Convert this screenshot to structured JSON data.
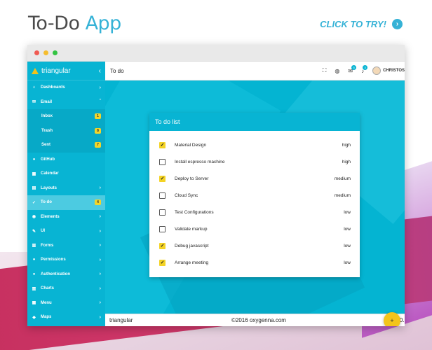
{
  "headline": {
    "prefix": "To-Do",
    "accent": "App"
  },
  "cta": {
    "label": "CLICK TO TRY!",
    "icon": "chevron-right-icon"
  },
  "brand": {
    "name": "triangular",
    "collapse_icon": "‹"
  },
  "sidebar": {
    "items": [
      {
        "label": "Dashboards",
        "icon": "⌂",
        "arrow": "›"
      },
      {
        "label": "Email",
        "icon": "✉",
        "arrow": "ˇ"
      },
      {
        "label": "Inbox",
        "badge": "1"
      },
      {
        "label": "Trash",
        "badge": "8"
      },
      {
        "label": "Sent",
        "badge": "7"
      },
      {
        "label": "GitHub",
        "icon": "●"
      },
      {
        "label": "Calendar",
        "icon": "▦"
      },
      {
        "label": "Layouts",
        "icon": "▤",
        "arrow": "›"
      },
      {
        "label": "To do",
        "icon": "✓",
        "badge": "4"
      },
      {
        "label": "Elements",
        "icon": "◉",
        "arrow": "›"
      },
      {
        "label": "UI",
        "icon": "✎",
        "arrow": "›"
      },
      {
        "label": "Forms",
        "icon": "▥",
        "arrow": "›"
      },
      {
        "label": "Permissions",
        "icon": "●",
        "arrow": "›"
      },
      {
        "label": "Authentication",
        "icon": "●",
        "arrow": "›"
      },
      {
        "label": "Charts",
        "icon": "▥",
        "arrow": "›"
      },
      {
        "label": "Menu",
        "icon": "▦",
        "arrow": "›"
      },
      {
        "label": "Maps",
        "icon": "◆",
        "arrow": "›"
      }
    ]
  },
  "topbar": {
    "title": "To do",
    "fullscreen_icon": "⛶",
    "globe_icon": "◍",
    "mail_icon": "✉",
    "mail_count": "5",
    "bell_icon": "♪",
    "bell_count": "3",
    "user": "CHRISTOS"
  },
  "card": {
    "title": "To do list",
    "todos": [
      {
        "label": "Material Design",
        "priority": "high",
        "checked": true
      },
      {
        "label": "Install espresso machine",
        "priority": "high",
        "checked": false
      },
      {
        "label": "Deploy to Server",
        "priority": "medium",
        "checked": true
      },
      {
        "label": "Cloud Sync",
        "priority": "medium",
        "checked": false
      },
      {
        "label": "Test Configurations",
        "priority": "low",
        "checked": false
      },
      {
        "label": "Validate markup",
        "priority": "low",
        "checked": false
      },
      {
        "label": "Debug javascript",
        "priority": "low",
        "checked": true
      },
      {
        "label": "Arrange meeting",
        "priority": "low",
        "checked": true
      }
    ]
  },
  "footer": {
    "brand": "triangular",
    "copyright": "©2016 oxygenna.com",
    "version": "v2.0.1"
  },
  "fab": {
    "icon": "+"
  },
  "colors": {
    "accent": "#08b4d3",
    "highlight": "#f3d52a",
    "headline_accent": "#35b2d6"
  }
}
